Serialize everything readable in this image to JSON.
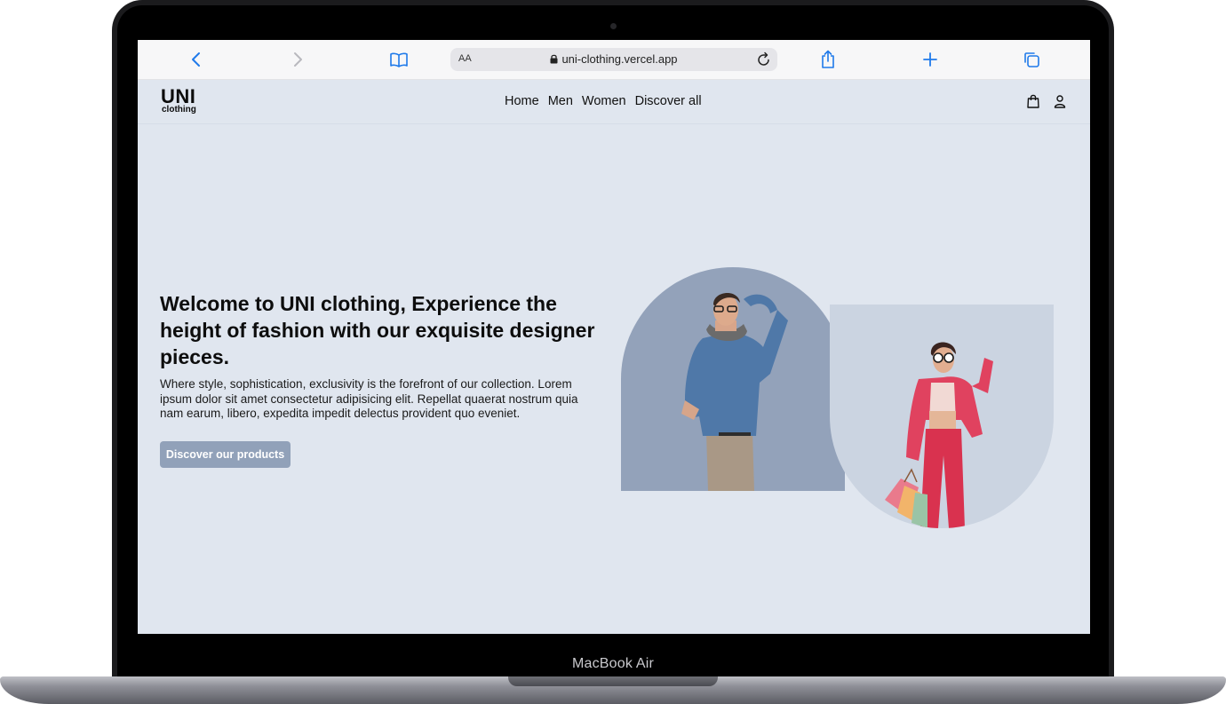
{
  "device": {
    "brand_label": "MacBook Air"
  },
  "browser": {
    "address_bar": {
      "text_size_label": "AA",
      "url": "uni-clothing.vercel.app"
    },
    "icons": [
      "back-icon",
      "forward-icon",
      "bookmarks-icon",
      "lock-icon",
      "reload-icon",
      "share-icon",
      "new-tab-icon",
      "tabs-icon"
    ]
  },
  "site": {
    "logo": {
      "main": "UNI",
      "sub": "clothing"
    },
    "nav": [
      "Home",
      "Men",
      "Women",
      "Discover all"
    ],
    "header_icons": [
      "cart-bag-icon",
      "user-icon"
    ],
    "hero": {
      "title": "Welcome to UNI clothing, Experience the height of fashion with our exquisite designer pieces.",
      "text": "Where style, sophistication, exclusivity is the forefront of our collection. Lorem ipsum dolor sit amet consectetur adipisicing elit. Repellat quaerat nostrum quia nam earum, libero, expedita impedit delectus provident quo eveniet.",
      "cta_label": "Discover our products"
    },
    "colors": {
      "page_bg": "#e0e6ef",
      "accent_button": "#91a1b9",
      "panel_dark": "#93a2ba",
      "panel_light": "#cbd4e1"
    }
  }
}
